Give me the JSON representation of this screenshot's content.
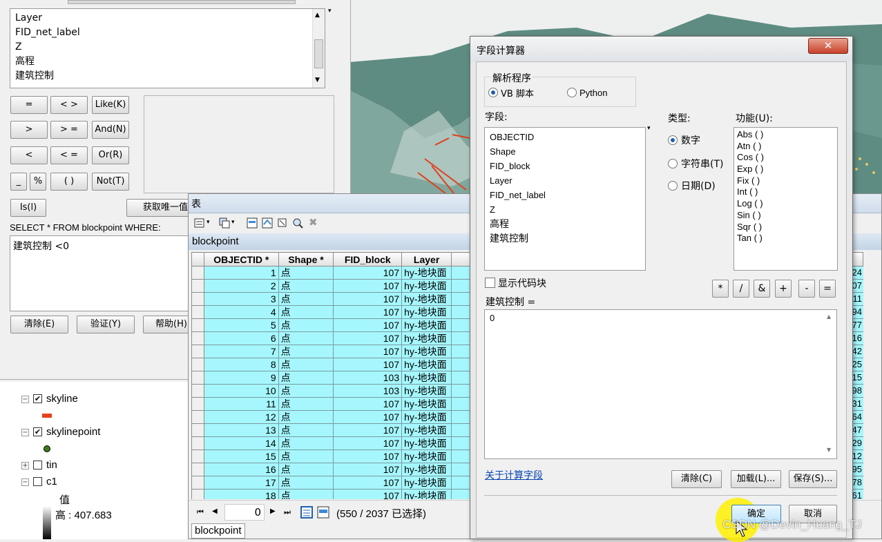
{
  "query_dialog": {
    "fields": [
      "Layer",
      "FID_net_label",
      "Z",
      "高程",
      "建筑控制"
    ],
    "operators": {
      "eq": "=",
      "ne": "< >",
      "like": "Like(K)",
      "gt": ">",
      "ge": "> =",
      "and": "And(N)",
      "lt": "<",
      "le": "< =",
      "or": "Or(R)",
      "underscore": "_",
      "percent": "%",
      "parens": "( )",
      "not": "Not(T)",
      "is": "Is(l)"
    },
    "get_unique_label": "获取唯一值",
    "sql_prefix": "SELECT * FROM blockpoint WHERE:",
    "expression": "建筑控制 <0",
    "clear_label": "清除(E)",
    "verify_label": "验证(Y)",
    "help_label": "帮助(H)"
  },
  "toc": {
    "layers": [
      {
        "name": "skyline",
        "checked": true
      },
      {
        "name": "skylinepoint",
        "checked": true
      },
      {
        "name": "tin",
        "checked": false
      },
      {
        "name": "c1",
        "checked": false
      }
    ],
    "value_header": "值",
    "high_label": "高 : 407.683"
  },
  "table_window": {
    "title": "表",
    "table_name": "blockpoint",
    "columns": [
      "OBJECTID *",
      "Shape *",
      "FID_block",
      "Layer"
    ],
    "rows": [
      [
        "1",
        "点",
        "107",
        "hy-地块面"
      ],
      [
        "2",
        "点",
        "107",
        "hy-地块面"
      ],
      [
        "3",
        "点",
        "107",
        "hy-地块面"
      ],
      [
        "4",
        "点",
        "107",
        "hy-地块面"
      ],
      [
        "5",
        "点",
        "107",
        "hy-地块面"
      ],
      [
        "6",
        "点",
        "107",
        "hy-地块面"
      ],
      [
        "7",
        "点",
        "107",
        "hy-地块面"
      ],
      [
        "8",
        "点",
        "107",
        "hy-地块面"
      ],
      [
        "9",
        "点",
        "103",
        "hy-地块面"
      ],
      [
        "10",
        "点",
        "103",
        "hy-地块面"
      ],
      [
        "11",
        "点",
        "107",
        "hy-地块面"
      ],
      [
        "12",
        "点",
        "107",
        "hy-地块面"
      ],
      [
        "13",
        "点",
        "107",
        "hy-地块面"
      ],
      [
        "14",
        "点",
        "107",
        "hy-地块面"
      ],
      [
        "15",
        "点",
        "107",
        "hy-地块面"
      ],
      [
        "16",
        "点",
        "107",
        "hy-地块面"
      ],
      [
        "17",
        "点",
        "107",
        "hy-地块面"
      ],
      [
        "18",
        "点",
        "107",
        "hy-地块面"
      ]
    ],
    "right_edge_values": [
      "24",
      "07",
      "11",
      "94",
      "77",
      "16",
      "42",
      "25",
      "15",
      "98",
      "31",
      "64",
      "47",
      "29",
      "12",
      "95",
      "78",
      "61"
    ],
    "record_position": "0",
    "selection_status": "(550 / 2037 已选择)",
    "bottom_tab": "blockpoint"
  },
  "field_calculator": {
    "title": "字段计算器",
    "parser_label": "解析程序",
    "parser_vb": "VB 脚本",
    "parser_python": "Python",
    "fields_label": "字段:",
    "fields": [
      "OBJECTID",
      "Shape",
      "FID_block",
      "Layer",
      "FID_net_label",
      "Z",
      "高程",
      "建筑控制"
    ],
    "type_label": "类型:",
    "type_number": "数字",
    "type_string": "字符串(T)",
    "type_date": "日期(D)",
    "functions_label": "功能(U):",
    "functions": [
      "Abs ( )",
      "Atn ( )",
      "Cos ( )",
      "Exp ( )",
      "Fix ( )",
      "Int ( )",
      "Log ( )",
      "Sin ( )",
      "Sqr ( )",
      "Tan ( )"
    ],
    "show_codeblock": "显示代码块",
    "operators": [
      "*",
      "/",
      "&",
      "+",
      "-",
      "="
    ],
    "expression_label": "建筑控制 =",
    "expression": "0",
    "about_link": "关于计算字段",
    "clear_label": "清除(C)",
    "load_label": "加载(L)...",
    "save_label": "保存(S)...",
    "ok_label": "确定",
    "cancel_label": "取消"
  },
  "watermark": "CSDN @Devin_Huang_TJ"
}
